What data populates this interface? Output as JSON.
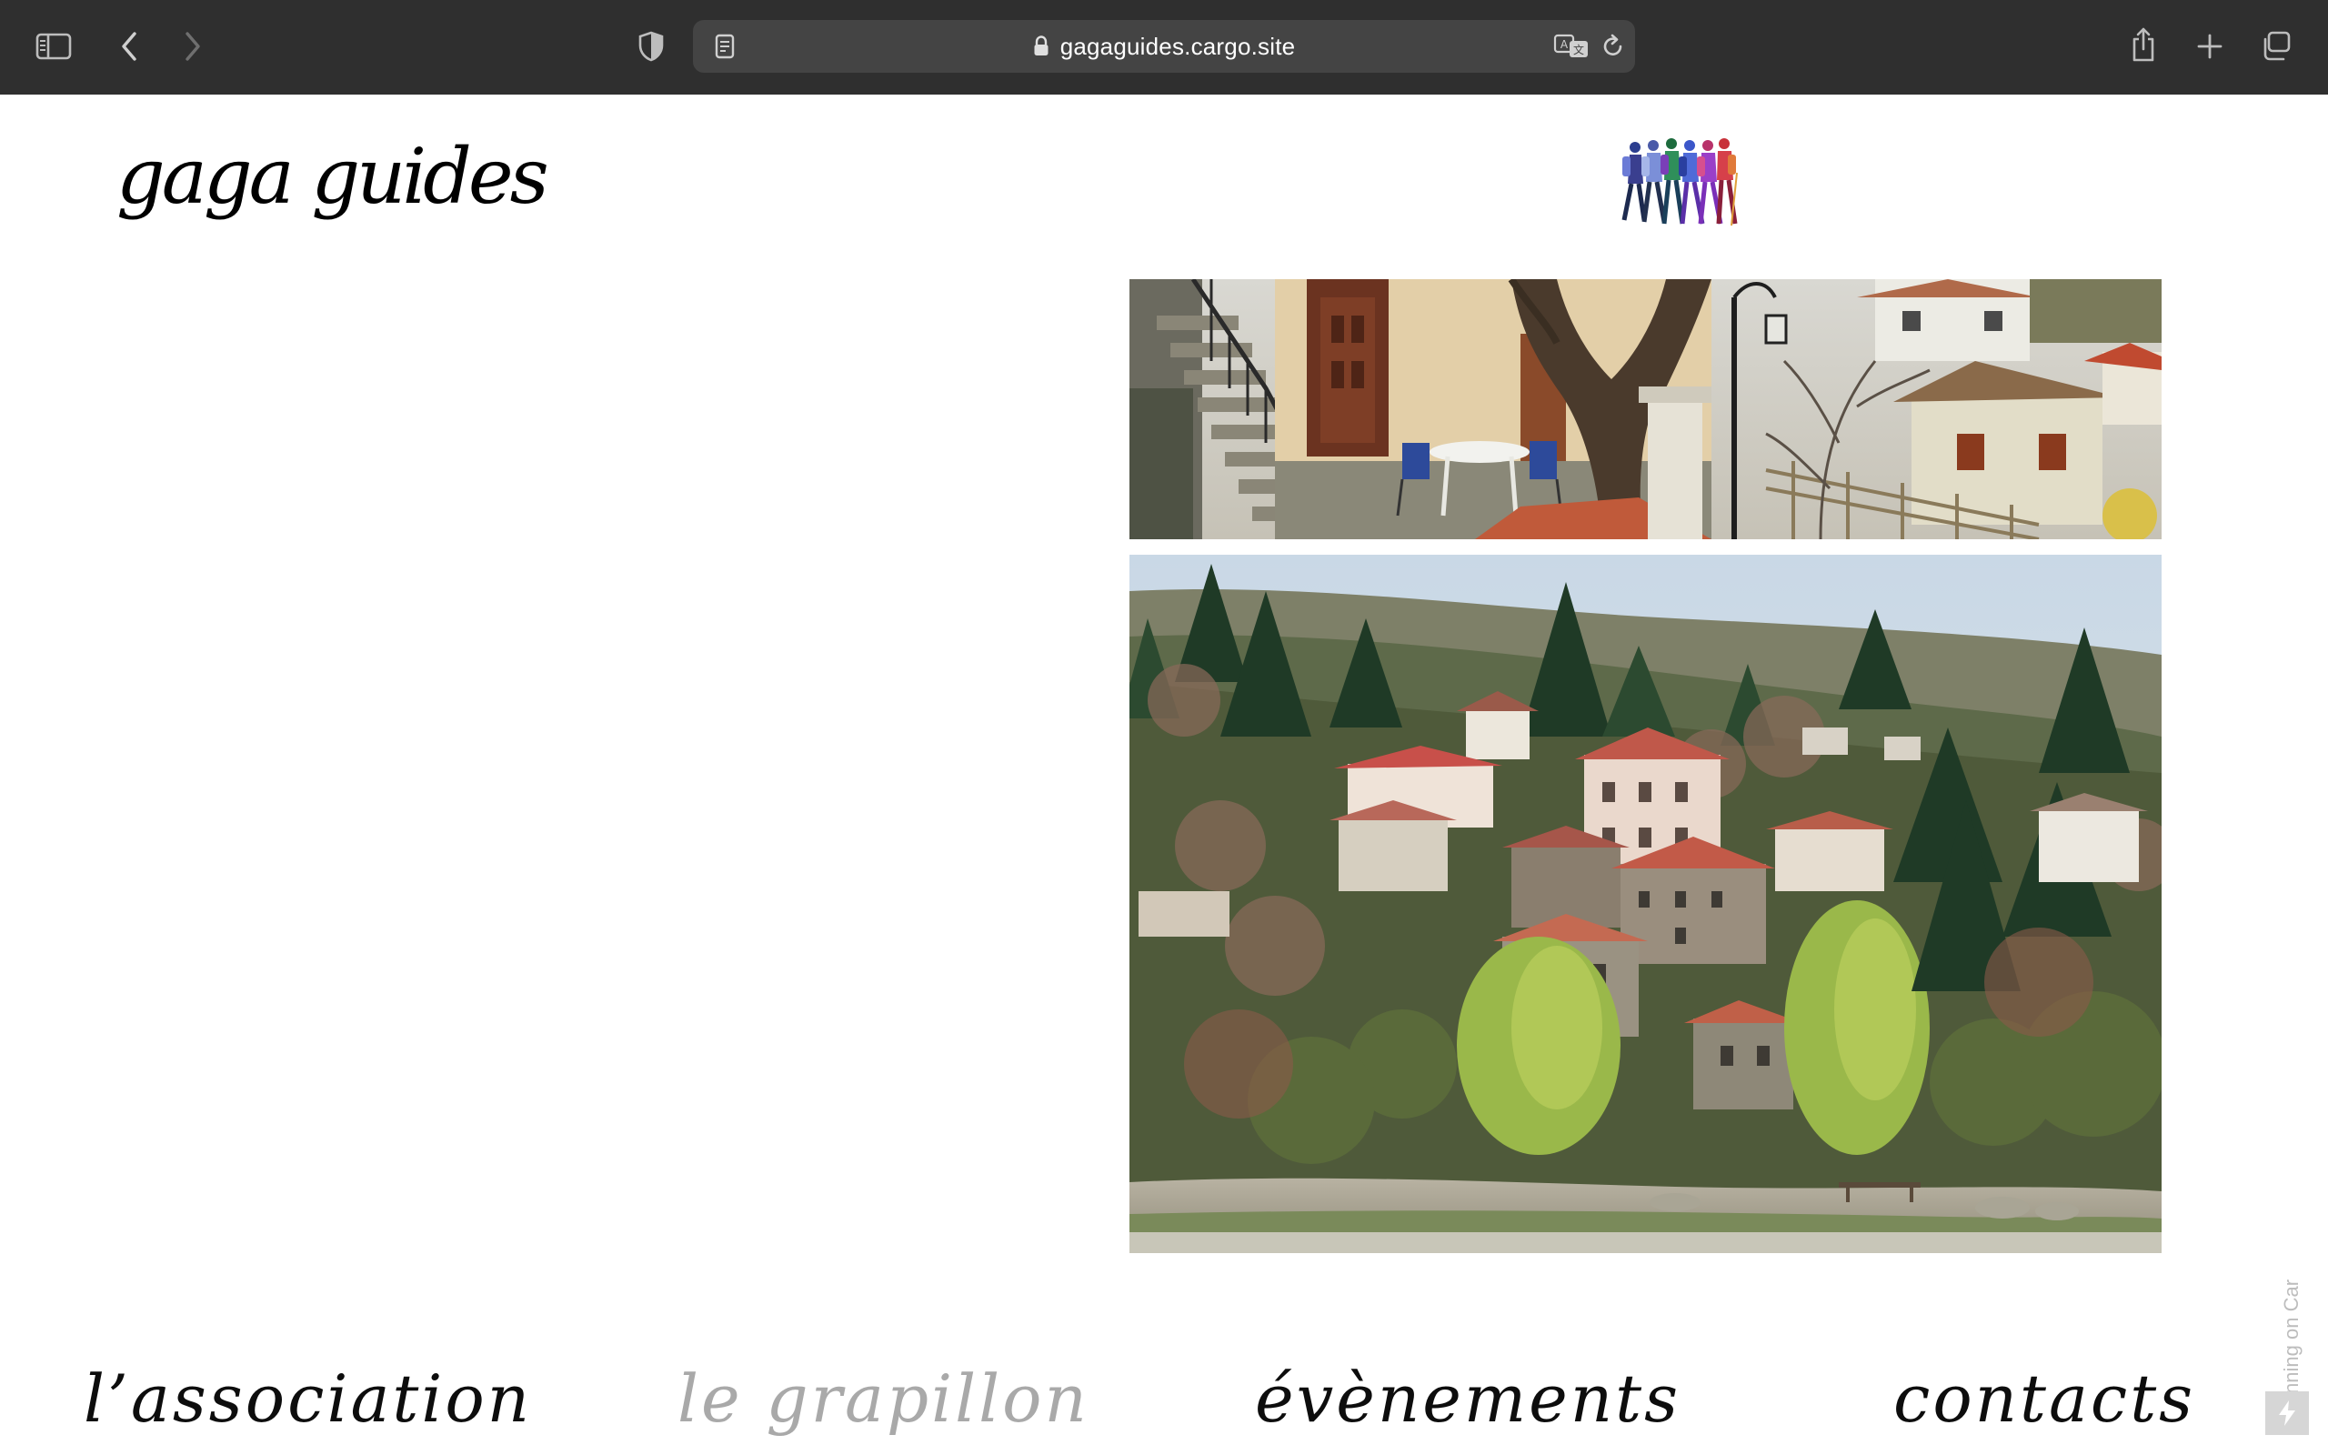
{
  "browser": {
    "url": "gagaguides.cargo.site"
  },
  "site": {
    "title": "gaga guides"
  },
  "nav": {
    "items": [
      {
        "label": "l’association"
      },
      {
        "label": "le grapillon"
      },
      {
        "label": "évènements"
      },
      {
        "label": "contacts"
      }
    ]
  },
  "footer": {
    "cargo_label": "Running on Car"
  },
  "icons": {
    "sidebar": "sidebar-icon",
    "back": "chevron-left-icon",
    "forward": "chevron-right-icon",
    "privacy": "shield-icon",
    "reader": "reader-icon",
    "lock": "lock-icon",
    "translate": "translate-icon",
    "reload": "reload-icon",
    "share": "share-icon",
    "new_tab": "plus-icon",
    "tabs": "tabs-overview-icon",
    "bolt": "bolt-icon"
  },
  "colors": {
    "toolbar": "#2f2f2f",
    "address_bar": "#444444",
    "nav_active": "#a9a9a9",
    "nav_text": "#0d0d0d"
  }
}
